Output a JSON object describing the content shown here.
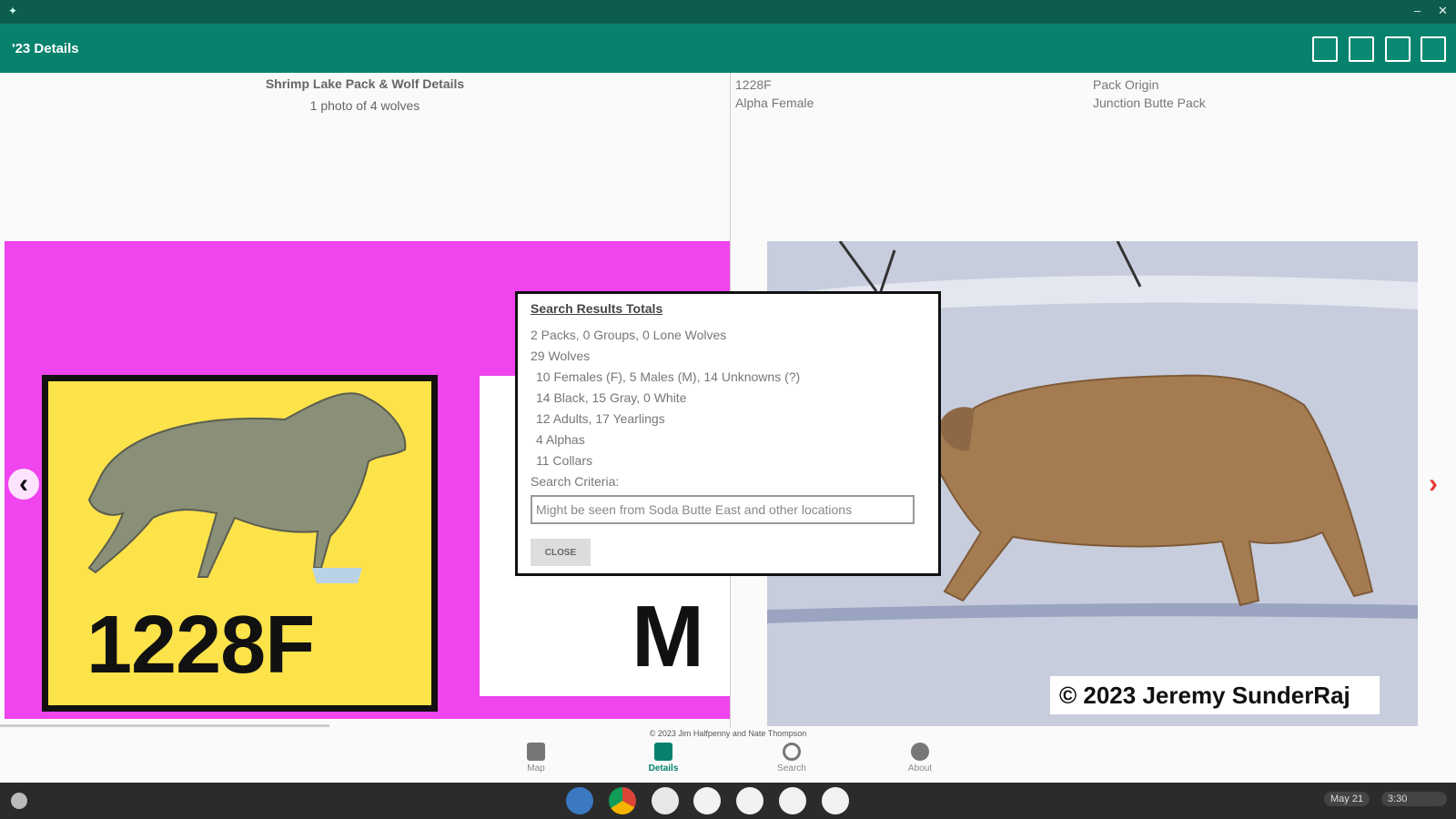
{
  "app": {
    "title": "'23 Details"
  },
  "window": {
    "minimize_glyph": "–",
    "close_glyph": "✕",
    "menu_glyph": "✦"
  },
  "left_pane": {
    "title": "Shrimp Lake Pack & Wolf Details",
    "subtitle": "1 photo of 4 wolves",
    "card_main_label": "1228F",
    "card_second_label": "M"
  },
  "right_pane": {
    "wolf_id": "1228F",
    "wolf_role": "Alpha Female",
    "origin_label": "Pack Origin",
    "origin_value": "Junction Butte Pack",
    "photo_copyright": "© 2023 Jeremy SunderRaj"
  },
  "dialog": {
    "title": "Search Results Totals",
    "lines": [
      "2 Packs, 0 Groups, 0 Lone Wolves",
      "29 Wolves",
      "10 Females (F), 5 Males (M), 14 Unknowns (?)",
      "14 Black, 15 Gray, 0 White",
      "12 Adults, 17 Yearlings",
      "4 Alphas",
      "11 Collars"
    ],
    "criteria_label": "Search Criteria:",
    "criteria_value": "Might be seen from Soda Butte East and other locations",
    "close_label": "CLOSE"
  },
  "footer": {
    "credit": "© 2023 Jim Halfpenny and Nate Thompson"
  },
  "bottom_nav": [
    {
      "label": "Map",
      "icon": "map-icon"
    },
    {
      "label": "Details",
      "icon": "wolf-icon"
    },
    {
      "label": "Search",
      "icon": "search-icon"
    },
    {
      "label": "About",
      "icon": "info-icon"
    }
  ],
  "shelf": {
    "date": "May 21",
    "time": "3:30"
  },
  "colors": {
    "appbar": "#06826d",
    "titlebar": "#0d5d4f",
    "magenta_background": "#f044ee",
    "card_yellow": "#fde34a",
    "nav_arrow_right": "#e53935"
  }
}
